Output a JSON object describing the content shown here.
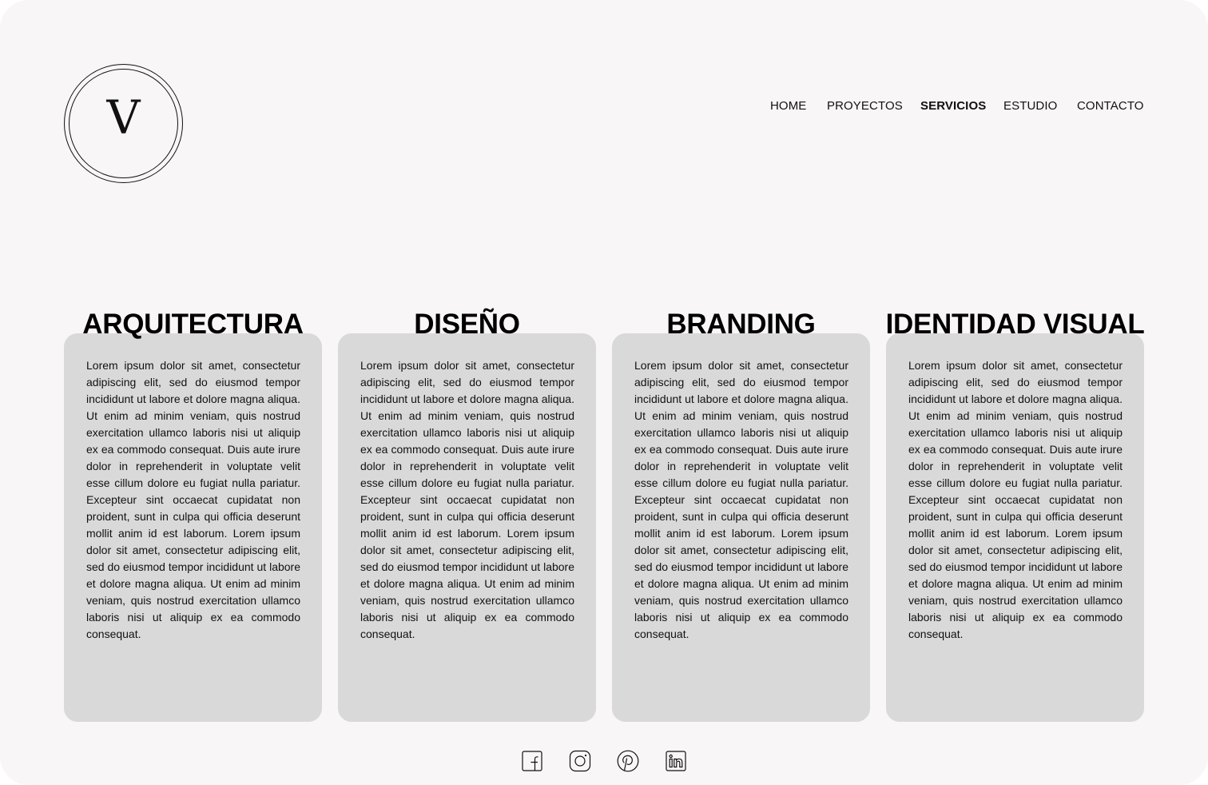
{
  "logo": {
    "letter": "V"
  },
  "nav": {
    "items": [
      {
        "label": "HOME",
        "active": false
      },
      {
        "label": "PROYECTOS",
        "active": false
      },
      {
        "label": "SERVICIOS",
        "active": true
      },
      {
        "label": "ESTUDIO",
        "active": false
      },
      {
        "label": "CONTACTO",
        "active": false
      }
    ]
  },
  "services": [
    {
      "title": "ARQUITECTURA",
      "text": "Lorem ipsum dolor sit amet, consectetur adipiscing elit, sed do eiusmod tempor incididunt ut labore et dolore magna aliqua. Ut enim ad minim veniam, quis nostrud exercitation ullamco laboris nisi ut aliquip ex ea commodo consequat. Duis aute irure dolor in reprehenderit in voluptate velit esse cillum dolore eu fugiat nulla pariatur. Excepteur sint occaecat cupidatat non proident, sunt in culpa qui officia deserunt mollit anim id est laborum. Lorem ipsum dolor sit amet, consectetur adipiscing elit, sed do eiusmod tempor incididunt ut labore et dolore magna aliqua. Ut enim ad minim veniam, quis nostrud exercitation ullamco laboris nisi ut aliquip ex ea commodo consequat."
    },
    {
      "title": "DISEÑO",
      "text": "Lorem ipsum dolor sit amet, consectetur adipiscing elit, sed do eiusmod tempor incididunt ut labore et dolore magna aliqua. Ut enim ad minim veniam, quis nostrud exercitation ullamco laboris nisi ut aliquip ex ea commodo consequat. Duis aute irure dolor in reprehenderit in voluptate velit esse cillum dolore eu fugiat nulla pariatur. Excepteur sint occaecat cupidatat non proident, sunt in culpa qui officia deserunt mollit anim id est laborum. Lorem ipsum dolor sit amet, consectetur adipiscing elit, sed do eiusmod tempor incididunt ut labore et dolore magna aliqua. Ut enim ad minim veniam, quis nostrud exercitation ullamco laboris nisi ut aliquip ex ea commodo consequat."
    },
    {
      "title": "BRANDING",
      "text": "Lorem ipsum dolor sit amet, consectetur adipiscing elit, sed do eiusmod tempor incididunt ut labore et dolore magna aliqua. Ut enim ad minim veniam, quis nostrud exercitation ullamco laboris nisi ut aliquip ex ea commodo consequat. Duis aute irure dolor in reprehenderit in voluptate velit esse cillum dolore eu fugiat nulla pariatur. Excepteur sint occaecat cupidatat non proident, sunt in culpa qui officia deserunt mollit anim id est laborum. Lorem ipsum dolor sit amet, consectetur adipiscing elit, sed do eiusmod tempor incididunt ut labore et dolore magna aliqua. Ut enim ad minim veniam, quis nostrud exercitation ullamco laboris nisi ut aliquip ex ea commodo consequat."
    },
    {
      "title": "IDENTIDAD VISUAL",
      "text": "Lorem ipsum dolor sit amet, consectetur adipiscing elit, sed do eiusmod tempor incididunt ut labore et dolore magna aliqua. Ut enim ad minim veniam, quis nostrud exercitation ullamco laboris nisi ut aliquip ex ea commodo consequat. Duis aute irure dolor in reprehenderit in voluptate velit esse cillum dolore eu fugiat nulla pariatur. Excepteur sint occaecat cupidatat non proident, sunt in culpa qui officia deserunt mollit anim id est laborum. Lorem ipsum dolor sit amet, consectetur adipiscing elit, sed do eiusmod tempor incididunt ut labore et dolore magna aliqua. Ut enim ad minim veniam, quis nostrud exercitation ullamco laboris nisi ut aliquip ex ea commodo consequat."
    }
  ],
  "social": {
    "icons": [
      "facebook-icon",
      "instagram-icon",
      "pinterest-icon",
      "linkedin-icon"
    ]
  },
  "colors": {
    "page_background": "#f8f6f7",
    "card_background": "#d9d9d9",
    "text": "#111111"
  }
}
